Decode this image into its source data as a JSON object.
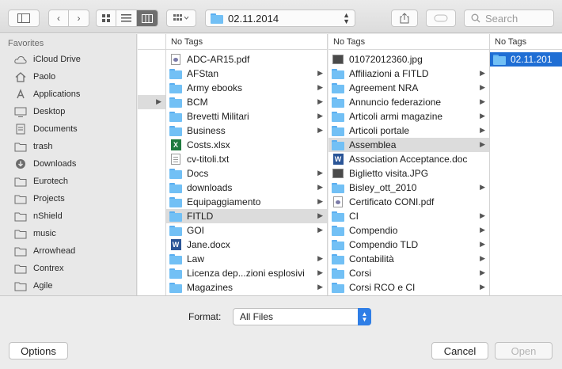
{
  "toolbar": {
    "path_label": "02.11.2014",
    "search_placeholder": "Search"
  },
  "sidebar": {
    "heading": "Favorites",
    "items": [
      {
        "label": "iCloud Drive",
        "icon": "cloud-icon"
      },
      {
        "label": "Paolo",
        "icon": "home-icon"
      },
      {
        "label": "Applications",
        "icon": "applications-icon"
      },
      {
        "label": "Desktop",
        "icon": "desktop-icon"
      },
      {
        "label": "Documents",
        "icon": "documents-icon"
      },
      {
        "label": "trash",
        "icon": "folder-icon"
      },
      {
        "label": "Downloads",
        "icon": "downloads-icon"
      },
      {
        "label": "Eurotech",
        "icon": "folder-icon"
      },
      {
        "label": "Projects",
        "icon": "folder-icon"
      },
      {
        "label": "nShield",
        "icon": "folder-icon"
      },
      {
        "label": "music",
        "icon": "folder-icon"
      },
      {
        "label": "Arrowhead",
        "icon": "folder-icon"
      },
      {
        "label": "Contrex",
        "icon": "folder-icon"
      },
      {
        "label": "Agile",
        "icon": "folder-icon"
      }
    ]
  },
  "columns": [
    {
      "header": "",
      "rows": [
        {
          "label": "",
          "type": "blank"
        },
        {
          "label": "",
          "type": "blank"
        },
        {
          "label": "",
          "type": "blank"
        },
        {
          "label": "",
          "type": "blank",
          "arrow": true,
          "selected": "grey"
        }
      ]
    },
    {
      "header": "No Tags",
      "rows": [
        {
          "label": "ADC-AR15.pdf",
          "type": "pdf"
        },
        {
          "label": "AFStan",
          "type": "folder",
          "arrow": true
        },
        {
          "label": "Army ebooks",
          "type": "folder",
          "arrow": true
        },
        {
          "label": "BCM",
          "type": "folder",
          "arrow": true
        },
        {
          "label": "Brevetti Militari",
          "type": "folder",
          "arrow": true
        },
        {
          "label": "Business",
          "type": "folder",
          "arrow": true
        },
        {
          "label": "Costs.xlsx",
          "type": "xls"
        },
        {
          "label": "cv-titoli.txt",
          "type": "txt"
        },
        {
          "label": "Docs",
          "type": "folder",
          "arrow": true
        },
        {
          "label": "downloads",
          "type": "folder",
          "arrow": true
        },
        {
          "label": "Equipaggiamento",
          "type": "folder",
          "arrow": true
        },
        {
          "label": "FITLD",
          "type": "folder",
          "arrow": true,
          "selected": "grey"
        },
        {
          "label": "GOI",
          "type": "folder",
          "arrow": true
        },
        {
          "label": "Jane.docx",
          "type": "word"
        },
        {
          "label": "Law",
          "type": "folder",
          "arrow": true
        },
        {
          "label": "Licenza dep...zioni esplosivi",
          "type": "folder",
          "arrow": true
        },
        {
          "label": "Magazines",
          "type": "folder",
          "arrow": true
        }
      ]
    },
    {
      "header": "No Tags",
      "rows": [
        {
          "label": "01072012360.jpg",
          "type": "img"
        },
        {
          "label": "Affiliazioni a FITLD",
          "type": "folder",
          "arrow": true
        },
        {
          "label": "Agreement NRA",
          "type": "folder",
          "arrow": true
        },
        {
          "label": "Annuncio federazione",
          "type": "folder",
          "arrow": true
        },
        {
          "label": "Articoli armi magazine",
          "type": "folder",
          "arrow": true
        },
        {
          "label": "Articoli portale",
          "type": "folder",
          "arrow": true
        },
        {
          "label": "Assemblea",
          "type": "folder",
          "arrow": true,
          "selected": "grey"
        },
        {
          "label": "Association Acceptance.doc",
          "type": "word"
        },
        {
          "label": "Biglietto visita.JPG",
          "type": "img"
        },
        {
          "label": "Bisley_ott_2010",
          "type": "folder",
          "arrow": true
        },
        {
          "label": "Certificato CONI.pdf",
          "type": "pdf"
        },
        {
          "label": "CI",
          "type": "folder",
          "arrow": true
        },
        {
          "label": "Compendio",
          "type": "folder",
          "arrow": true
        },
        {
          "label": "Compendio TLD",
          "type": "folder",
          "arrow": true
        },
        {
          "label": "Contabilità",
          "type": "folder",
          "arrow": true
        },
        {
          "label": "Corsi",
          "type": "folder",
          "arrow": true
        },
        {
          "label": "Corsi RCO e CI",
          "type": "folder",
          "arrow": true
        }
      ]
    },
    {
      "header": "No Tags",
      "rows": [
        {
          "label": "02.11.201",
          "type": "folder",
          "selected": "blue"
        }
      ]
    }
  ],
  "format": {
    "label": "Format:",
    "value": "All Files"
  },
  "buttons": {
    "options": "Options",
    "cancel": "Cancel",
    "open": "Open"
  },
  "colors": {
    "selection": "#1f6ed4",
    "folder": "#72c0f5",
    "accent": "#2f7ee6"
  }
}
